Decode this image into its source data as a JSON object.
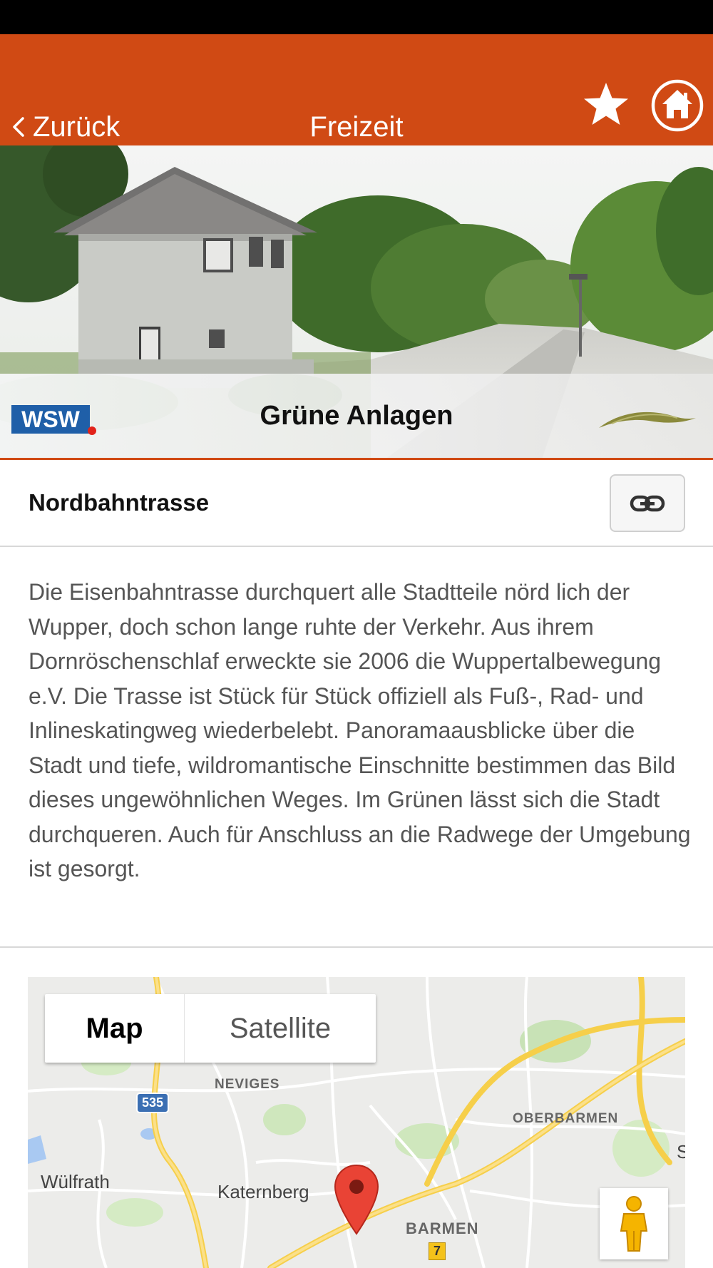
{
  "nav": {
    "back_label": "Zurück",
    "title": "Freizeit",
    "accent_color": "#d04a14"
  },
  "icons": {
    "back": "chevron-left-icon",
    "favorite": "star-icon",
    "home": "home-icon",
    "link": "link-icon",
    "map_pin": "map-pin-icon",
    "street_view": "pegman-icon"
  },
  "banner": {
    "logo_text": "WSW",
    "title": "Grüne Anlagen"
  },
  "item": {
    "title": "Nordbahntrasse",
    "description": "Die Eisenbahntrasse durchquert alle Stadtteile nörd lich der Wupper, doch schon lange ruhte der Verkehr. Aus ihrem Dornröschenschlaf erweckte sie 2006 die Wuppertalbewegung e.V. Die Trasse ist Stück für Stück offiziell als Fuß-, Rad- und Inlineskatingweg wiederbelebt. Panoramaausblicke über die Stadt und tiefe, wildromantische Einschnitte bestimmen das Bild dieses ungewöhnlichen Weges. Im Grünen lässt sich die Stadt durchqueren. Auch für Anschluss an die Radwege der Umgebung ist gesorgt."
  },
  "map": {
    "type_options": [
      "Map",
      "Satellite"
    ],
    "selected_type": "Map",
    "labels": {
      "neviges": "NEVIGES",
      "oberbarmen": "OBERBARMEN",
      "wuelfrath": "Wülfrath",
      "katernberg": "Katernberg",
      "barmen": "BARMEN",
      "edge_s": "S"
    },
    "road_badges": {
      "b535": "535",
      "b7": "7"
    }
  }
}
